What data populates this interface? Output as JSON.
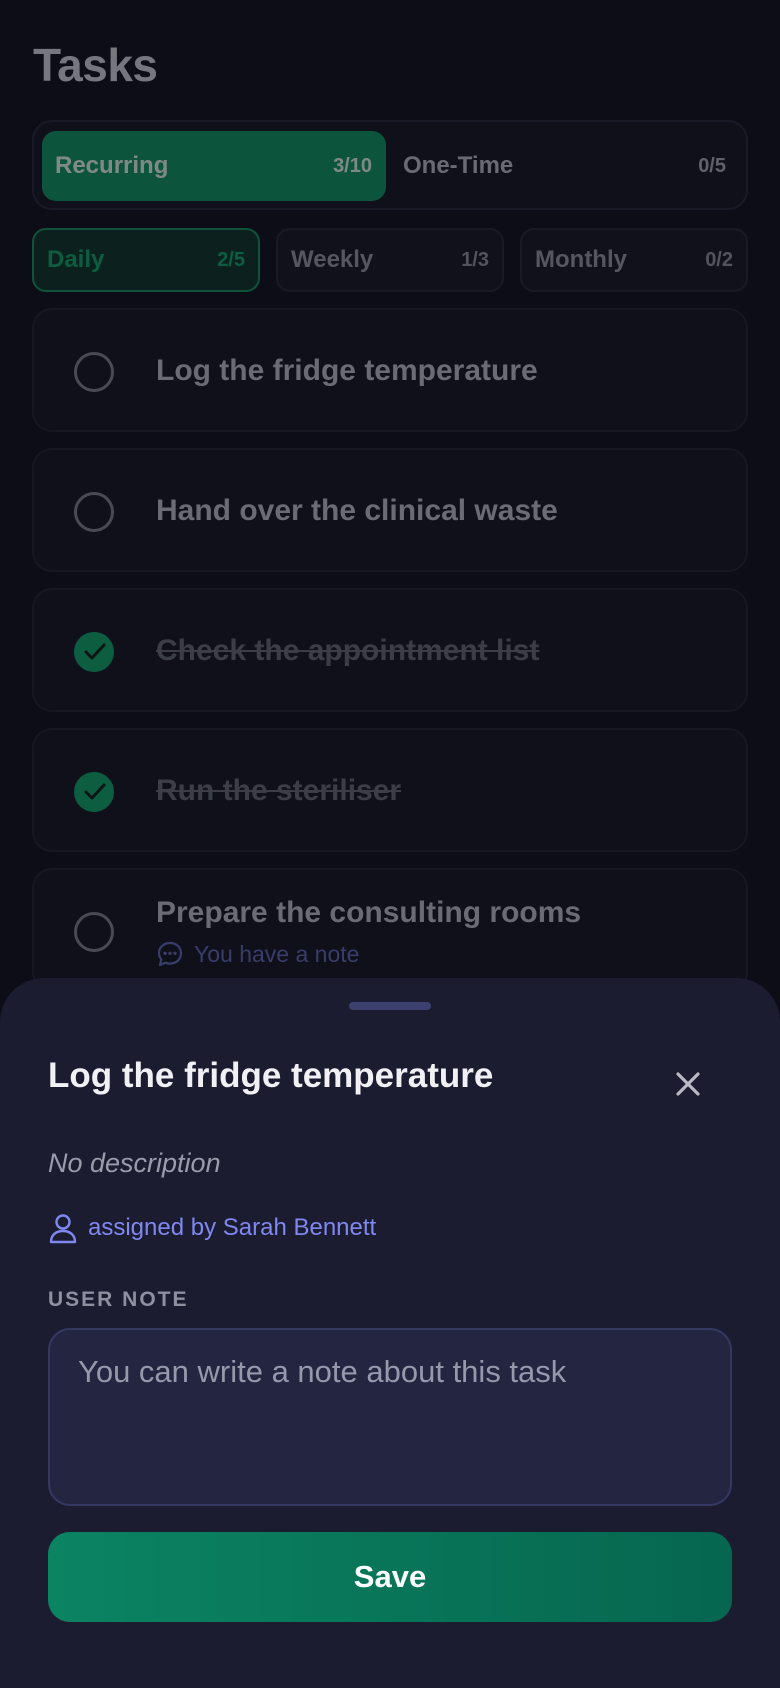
{
  "page": {
    "title": "Tasks"
  },
  "tabs": {
    "recurring": {
      "label": "Recurring",
      "count": "3/10"
    },
    "one_time": {
      "label": "One-Time",
      "count": "0/5"
    }
  },
  "subtabs": {
    "daily": {
      "label": "Daily",
      "count": "2/5"
    },
    "weekly": {
      "label": "Weekly",
      "count": "1/3"
    },
    "monthly": {
      "label": "Monthly",
      "count": "0/2"
    }
  },
  "tasks": [
    {
      "title": "Log the fridge temperature",
      "done": false
    },
    {
      "title": "Hand over the clinical waste",
      "done": false
    },
    {
      "title": "Check the appointment list",
      "done": true
    },
    {
      "title": "Run the steriliser",
      "done": true
    },
    {
      "title": "Prepare the consulting rooms",
      "done": false,
      "note": "You have a note"
    }
  ],
  "sheet": {
    "title": "Log the fridge temperature",
    "description": "No description",
    "assigned": "assigned by Sarah Bennett",
    "note_label": "USER NOTE",
    "note_placeholder": "You can write a note about this task",
    "save_label": "Save"
  },
  "colors": {
    "accent": "#0f7a52",
    "link": "#7f88f0",
    "sheet_bg": "#1b1c30",
    "page_bg": "#0e0f1a"
  },
  "icons": {
    "check": "checkmark-icon",
    "note": "chat-bubble-icon",
    "user": "user-icon",
    "close": "close-icon"
  }
}
